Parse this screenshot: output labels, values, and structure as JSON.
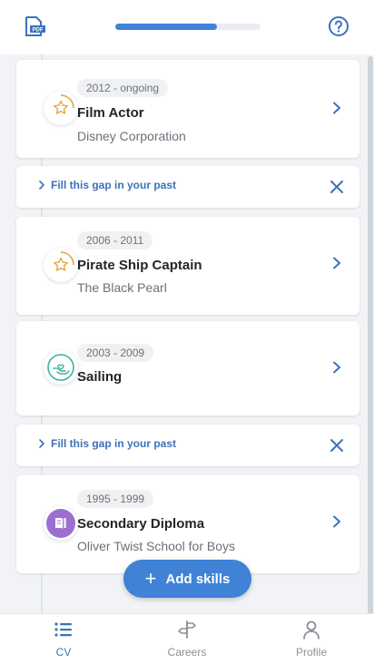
{
  "header": {
    "pdf_icon": "pdf-file-icon",
    "help_icon": "question-circle-icon",
    "progress_percent": 70
  },
  "timeline": [
    {
      "type": "entry",
      "date": "2012 - ongoing",
      "title": "Film Actor",
      "subtitle": "Disney Corporation",
      "icon": "star-icon"
    },
    {
      "type": "gap",
      "label": "Fill this gap in your past"
    },
    {
      "type": "entry",
      "date": "2006 - 2011",
      "title": "Pirate Ship Captain",
      "subtitle": "The Black Pearl",
      "icon": "star-icon"
    },
    {
      "type": "entry",
      "date": "2003 - 2009",
      "title": "Sailing",
      "subtitle": "",
      "icon": "hand-heart-icon"
    },
    {
      "type": "gap",
      "label": "Fill this gap in your past"
    },
    {
      "type": "entry",
      "date": "1995 - 1999",
      "title": "Secondary Diploma",
      "subtitle": "Oliver Twist School for Boys",
      "icon": "book-icon"
    }
  ],
  "fab": {
    "label": "Add skills",
    "icon": "plus-icon"
  },
  "tabs": [
    {
      "label": "CV",
      "icon": "list-icon",
      "active": true
    },
    {
      "label": "Careers",
      "icon": "signpost-icon",
      "active": false
    },
    {
      "label": "Profile",
      "icon": "person-icon",
      "active": false
    }
  ],
  "colors": {
    "accent": "#3f82d6",
    "link": "#3d72b8",
    "star": "#e0a93b",
    "sailing": "#3bb39a",
    "education": "#9b6fd0"
  }
}
